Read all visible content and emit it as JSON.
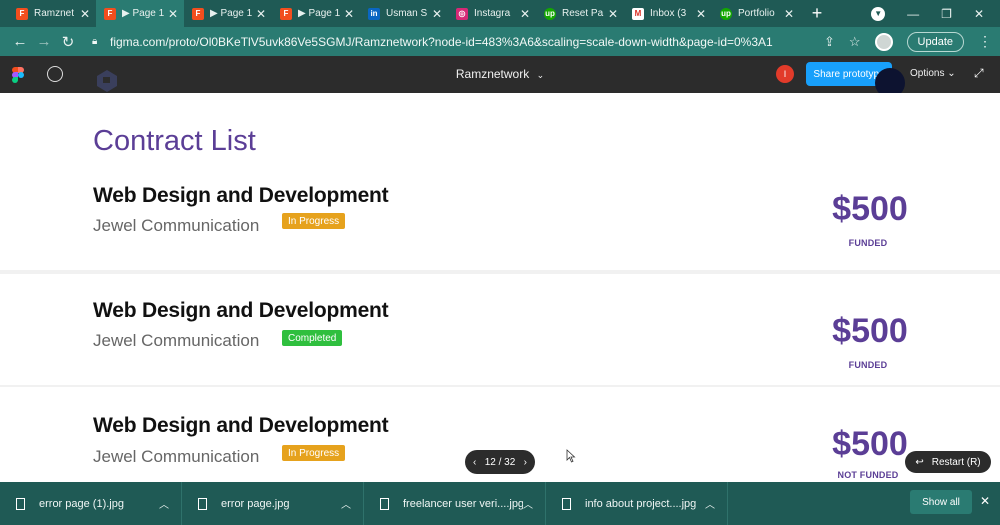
{
  "browser": {
    "tabs": [
      {
        "label": "Ramznet",
        "favicon": "figma-icon",
        "active": false
      },
      {
        "label": "▶ Page 1",
        "favicon": "figma-icon",
        "active": true
      },
      {
        "label": "▶ Page 1",
        "favicon": "figma-icon",
        "active": false
      },
      {
        "label": "▶ Page 1",
        "favicon": "figma-icon",
        "active": false
      },
      {
        "label": "Usman S",
        "favicon": "linkedin-icon",
        "active": false
      },
      {
        "label": "Instagra",
        "favicon": "instagram-icon",
        "active": false
      },
      {
        "label": "Reset Pa",
        "favicon": "upwork-icon",
        "active": false
      },
      {
        "label": "Inbox (3",
        "favicon": "gmail-icon",
        "active": false
      },
      {
        "label": "Portfolio",
        "favicon": "upwork-icon",
        "active": false
      }
    ],
    "new_tab_label": "+",
    "url": "figma.com/proto/Ol0BKeTlV5uvk86Ve5SGMJ/Ramznetwork?node-id=483%3A6&scaling=scale-down-width&page-id=0%3A1",
    "update_label": "Update"
  },
  "figma": {
    "project_name": "Ramznetwork",
    "share_label": "Share prototype",
    "options_label": "Options",
    "user_initial": "I"
  },
  "page": {
    "title": "Contract List",
    "contracts": [
      {
        "title": "Web Design and Development",
        "client": "Jewel Communication",
        "status": "In Progress",
        "amount": "$500",
        "funding": "FUNDED"
      },
      {
        "title": "Web Design and Development",
        "client": "Jewel Communication",
        "status": "Completed",
        "amount": "$500",
        "funding": "FUNDED"
      },
      {
        "title": "Web Design and Development",
        "client": "Jewel Communication",
        "status": "In Progress",
        "amount": "$500",
        "funding": "NOT FUNDED"
      }
    ]
  },
  "prototype_controls": {
    "page_counter": "12 / 32",
    "restart_label": "Restart (R)"
  },
  "downloads": {
    "items": [
      "error page (1).jpg",
      "error page.jpg",
      "freelancer user veri....jpg",
      "info about project....jpg"
    ],
    "show_all_label": "Show all"
  },
  "colors": {
    "accent_purple": "#5b3e96",
    "status_in_progress": "#e6a21d",
    "status_completed": "#2fbf3e",
    "share_blue": "#18a0fb",
    "browser_teal": "#1f5a55"
  }
}
